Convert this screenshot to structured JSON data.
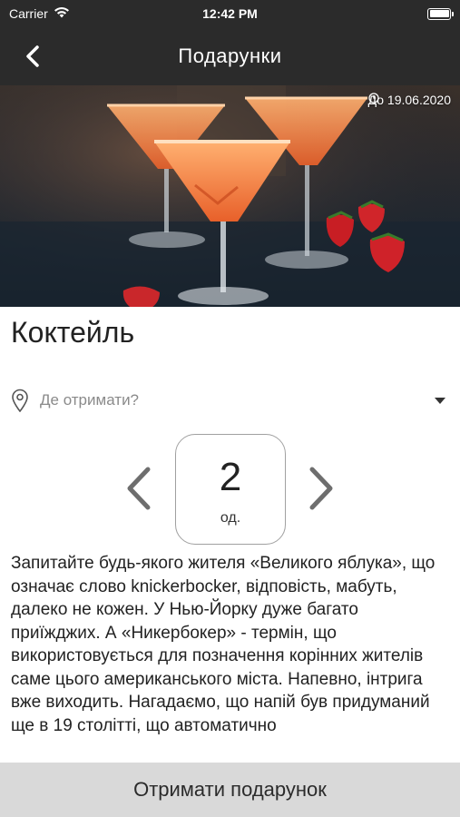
{
  "status_bar": {
    "carrier": "Carrier",
    "time": "12:42 PM"
  },
  "nav": {
    "title": "Подарунки"
  },
  "hero": {
    "validity": "До 19.06.2020"
  },
  "product": {
    "title": "Коктейль"
  },
  "location": {
    "placeholder": "Де отримати?"
  },
  "quantity": {
    "value": "2",
    "unit": "од."
  },
  "description": "Запитайте будь-якого жителя «Великого яблука», що означає слово knickerbocker, відповість, мабуть, далеко не кожен. У Нью-Йорку дуже багато приїжджих. А «Никербокер» - термін, що використовується для позначення корінних жителів саме цього американського міста. Напевно, інтрига вже виходить. Нагадаємо, що напій був придуманий ще в 19 столітті, що автоматично",
  "actions": {
    "get_gift": "Отримати подарунок"
  },
  "colors": {
    "header_bg": "#2b2b2b",
    "button_bg": "#d9d9d9",
    "cocktail": "#f0803a"
  },
  "icons": [
    "wifi-icon",
    "battery-icon",
    "back-chevron-icon",
    "clock-icon",
    "location-pin-icon",
    "dropdown-caret-icon",
    "chevron-left-icon",
    "chevron-right-icon"
  ]
}
